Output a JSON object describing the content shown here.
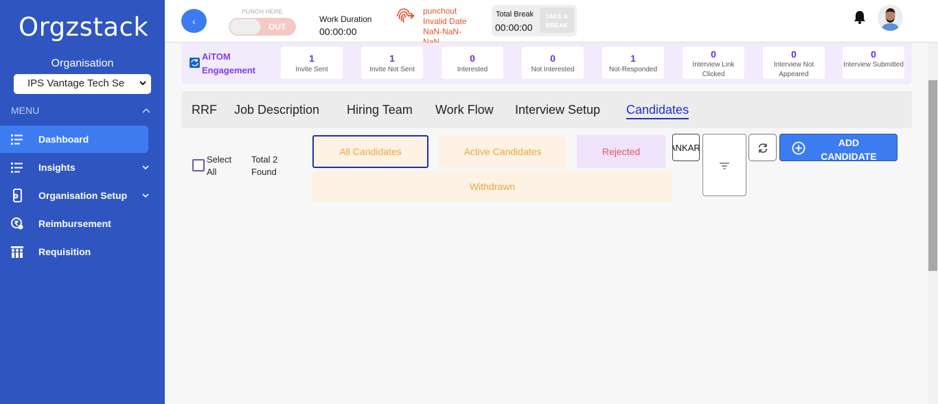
{
  "app": {
    "logo_text": "Orgzstack"
  },
  "sidebar": {
    "org_label": "Organisation",
    "org_selected": "IPS Vantage Tech Se",
    "menu_label": "MENU",
    "items": [
      {
        "label": "Dashboard",
        "icon": "dashboard-list-icon",
        "active": true
      },
      {
        "label": "Insights",
        "icon": "insights-list-icon",
        "has_dropdown": true
      },
      {
        "label": "Organisation Setup",
        "icon": "org-setup-icon",
        "has_dropdown": true
      },
      {
        "label": "Reimbursement",
        "icon": "reimbursement-icon"
      },
      {
        "label": "Requisition",
        "icon": "requisition-icon"
      }
    ]
  },
  "header": {
    "back_symbol": "‹",
    "punch_label": "PUNCH HERE",
    "punch_state": "OUT",
    "work_duration_label": "Work Duration",
    "work_duration_value": "00:00:00",
    "punchout_text": "punchout Invalid Date NaN-NaN-NaN",
    "total_break_label": "Total Break",
    "total_break_value": "00:00:00",
    "take_break_label": "TAKE A BREAK"
  },
  "engagement": {
    "title": "AiTOM Engagement",
    "stats": [
      {
        "value": "1",
        "label": "Invite Sent"
      },
      {
        "value": "1",
        "label": "Invite Not Sent"
      },
      {
        "value": "0",
        "label": "Interested"
      },
      {
        "value": "0",
        "label": "Not Interested"
      },
      {
        "value": "1",
        "label": "Not-Responded"
      },
      {
        "value": "0",
        "label": "Interview Link Clicked"
      },
      {
        "value": "0",
        "label": "Interview Not Appeared"
      },
      {
        "value": "0",
        "label": "Interview Submitted"
      }
    ]
  },
  "tabs": [
    {
      "label": "RRF"
    },
    {
      "label": "Job Description"
    },
    {
      "label": "Hiring Team"
    },
    {
      "label": "Work Flow"
    },
    {
      "label": "Interview Setup"
    },
    {
      "label": "Candidates",
      "active": true
    }
  ],
  "candidates": {
    "select_all_label": "Select All",
    "total_found": "Total 2 Found",
    "filters": {
      "all": "All Candidates",
      "active": "Active Candidates",
      "rejected": "Rejected",
      "withdrawn": "Withdrawn"
    },
    "search_value": "ANKAR",
    "add_button": "ADD CANDIDATE"
  },
  "colors": {
    "sidebar": "#2f55c0",
    "accent": "#3d7cf0",
    "engagement_value": "#6a2fd8",
    "punchout_text": "#e2522b"
  }
}
